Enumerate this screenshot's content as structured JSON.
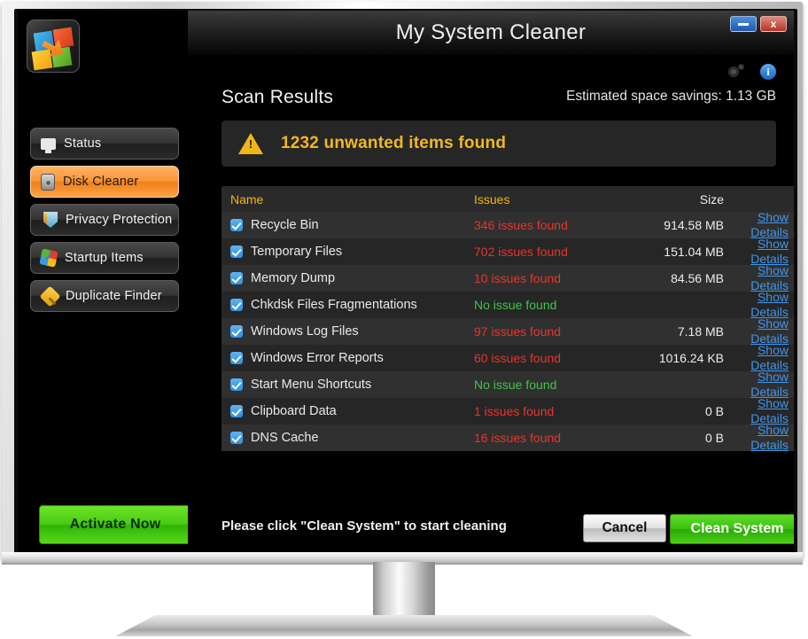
{
  "window": {
    "title": "My System Cleaner",
    "minimize_label": "–",
    "close_label": "x"
  },
  "sidebar": {
    "logo_name": "app-logo",
    "items": [
      {
        "label": "Status",
        "icon": "monitor-icon",
        "active": false
      },
      {
        "label": "Disk Cleaner",
        "icon": "disk-icon",
        "active": true
      },
      {
        "label": "Privacy Protection",
        "icon": "shield-icon",
        "active": false
      },
      {
        "label": "Startup Items",
        "icon": "startup-icon",
        "active": false
      },
      {
        "label": "Duplicate Finder",
        "icon": "diamond-icon",
        "active": false
      }
    ],
    "activate_label": "Activate Now"
  },
  "toolbar": {
    "gear_icon": "gear-icon",
    "info_icon": "info-icon",
    "info_label": "i"
  },
  "main": {
    "heading": "Scan Results",
    "savings": "Estimated space savings: 1.13 GB",
    "alert": {
      "icon": "warning-icon",
      "text": "1232 unwanted items found"
    }
  },
  "table": {
    "columns": {
      "name": "Name",
      "issues": "Issues",
      "size": "Size",
      "details": ""
    },
    "details_label": "Show Details",
    "rows": [
      {
        "checked": true,
        "name": "Recycle Bin",
        "issues": "346 issues found",
        "issue_state": "bad",
        "size": "914.58 MB"
      },
      {
        "checked": true,
        "name": "Temporary Files",
        "issues": "702 issues found",
        "issue_state": "bad",
        "size": "151.04 MB"
      },
      {
        "checked": true,
        "name": "Memory Dump",
        "issues": "10 issues found",
        "issue_state": "bad",
        "size": "84.56 MB"
      },
      {
        "checked": true,
        "name": "Chkdsk Files Fragmentations",
        "issues": "No issue found",
        "issue_state": "good",
        "size": ""
      },
      {
        "checked": true,
        "name": "Windows Log Files",
        "issues": "97 issues found",
        "issue_state": "bad",
        "size": "7.18 MB"
      },
      {
        "checked": true,
        "name": "Windows Error Reports",
        "issues": "60 issues found",
        "issue_state": "bad",
        "size": "1016.24 KB"
      },
      {
        "checked": true,
        "name": "Start Menu Shortcuts",
        "issues": "No issue found",
        "issue_state": "good",
        "size": ""
      },
      {
        "checked": true,
        "name": "Clipboard Data",
        "issues": "1 issues found",
        "issue_state": "bad",
        "size": "0 B"
      },
      {
        "checked": true,
        "name": "DNS Cache",
        "issues": "16 issues found",
        "issue_state": "bad",
        "size": "0 B"
      }
    ]
  },
  "footer": {
    "message": "Please click \"Clean System\" to start cleaning",
    "cancel_label": "Cancel",
    "clean_label": "Clean System"
  },
  "colors": {
    "accent_orange": "#f08017",
    "alert_yellow": "#f2b721",
    "header_gold": "#f0b80f",
    "issue_bad": "#e8342a",
    "issue_good": "#3fc54a",
    "link_blue": "#3f96ec",
    "green_button": "#3cc40f"
  }
}
